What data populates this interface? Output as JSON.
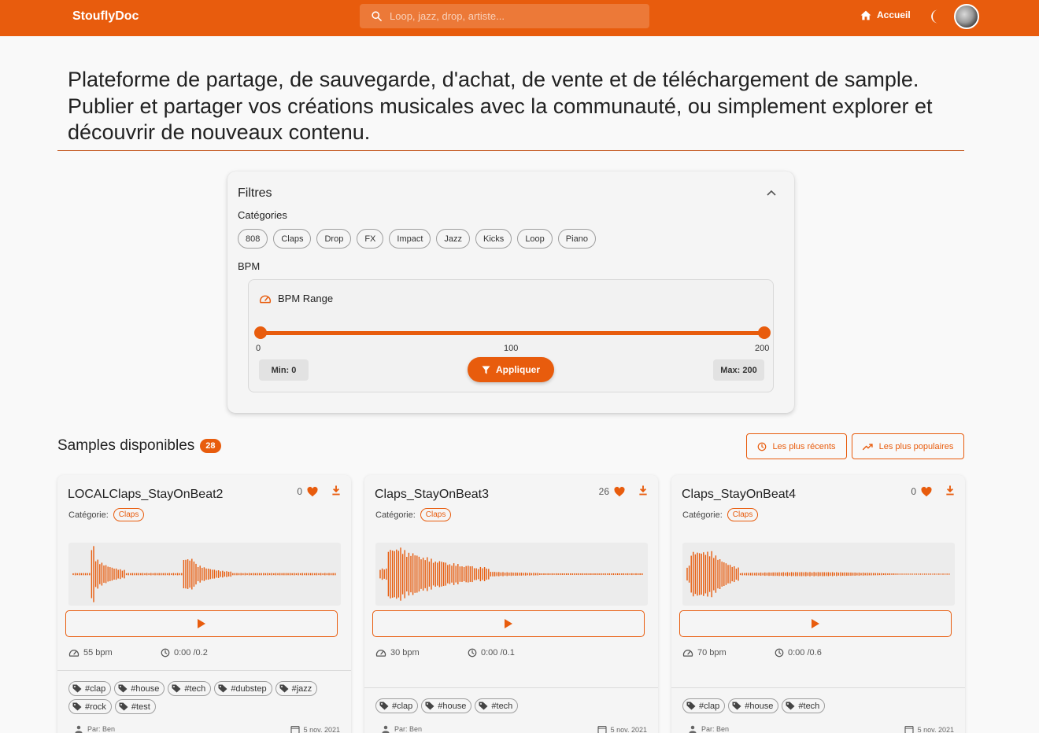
{
  "header": {
    "brand": "StouflyDoc",
    "search_placeholder": "Loop, jazz, drop, artiste...",
    "home_label": "Accueil",
    "accent_color": "#e85c0d"
  },
  "intro": {
    "text": "Plateforme de partage, de sauvegarde, d'achat, de vente et de téléchargement de sample. Publier et partager vos créations musicales avec la communauté, ou simplement explorer et découvrir de nouveaux contenu."
  },
  "filters": {
    "title": "Filtres",
    "categories_label": "Catégories",
    "categories": [
      "808",
      "Claps",
      "Drop",
      "FX",
      "Impact",
      "Jazz",
      "Kicks",
      "Loop",
      "Piano"
    ],
    "bpm_label": "BPM",
    "bpm_range_title": "BPM Range",
    "ticks": [
      "0",
      "100",
      "200"
    ],
    "min_label": "Min: 0",
    "max_label": "Max: 200",
    "apply_label": "Appliquer",
    "range_min": 0,
    "range_max": 200
  },
  "samples": {
    "title": "Samples disponibles",
    "count": "28",
    "sort_recent": "Les plus récents",
    "sort_popular": "Les plus populaires",
    "category_label": "Catégorie:",
    "cards": [
      {
        "title": "LOCALClaps_StayOnBeat2",
        "likes": "0",
        "category": "Claps",
        "bpm": "55 bpm",
        "duration": "0:00 /0.2",
        "tags": [
          "#clap",
          "#house",
          "#tech",
          "#dubstep",
          "#jazz",
          "#rock",
          "#test"
        ],
        "author": "Par: Ben",
        "date": "5 nov. 2021"
      },
      {
        "title": "Claps_StayOnBeat3",
        "likes": "26",
        "category": "Claps",
        "bpm": "30 bpm",
        "duration": "0:00 /0.1",
        "tags": [
          "#clap",
          "#house",
          "#tech"
        ],
        "author": "Par: Ben",
        "date": "5 nov. 2021"
      },
      {
        "title": "Claps_StayOnBeat4",
        "likes": "0",
        "category": "Claps",
        "bpm": "70 bpm",
        "duration": "0:00 /0.6",
        "tags": [
          "#clap",
          "#house",
          "#tech"
        ],
        "author": "Par: Ben",
        "date": "5 nov. 2021"
      }
    ]
  }
}
